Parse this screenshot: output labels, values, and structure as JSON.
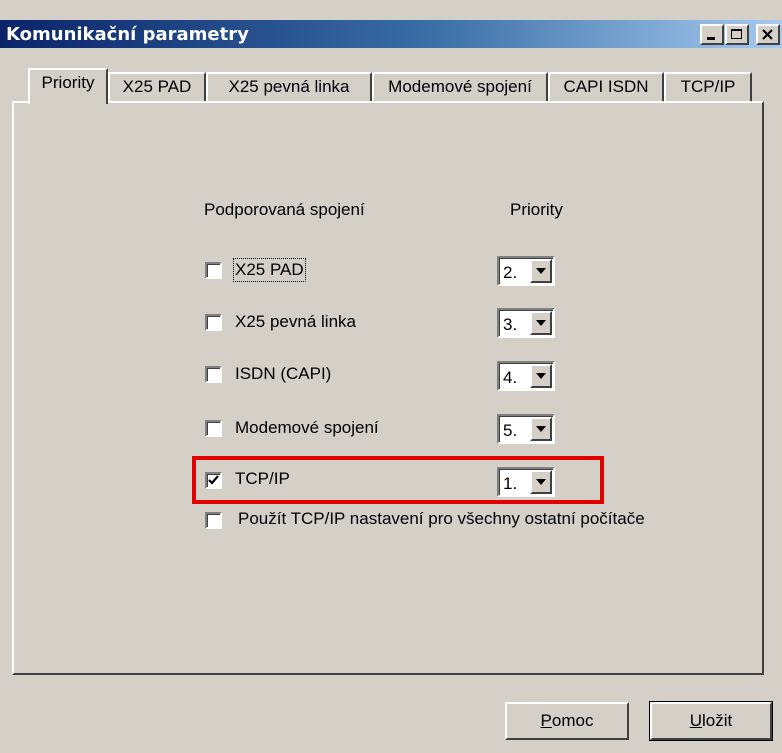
{
  "window": {
    "title": "Komunikační parametry",
    "accent_color": "#0a246a",
    "highlight_color": "#e00000"
  },
  "tabs": [
    {
      "label": "Priority",
      "active": true
    },
    {
      "label": "X25 PAD",
      "active": false
    },
    {
      "label": "X25  pevná linka",
      "active": false
    },
    {
      "label": "Modemové spojení",
      "active": false
    },
    {
      "label": "CAPI ISDN",
      "active": false
    },
    {
      "label": "TCP/IP",
      "active": false
    }
  ],
  "headers": {
    "connections": "Podporovaná spojení",
    "priority": "Priority"
  },
  "connections": [
    {
      "label": "X25 PAD",
      "checked": false,
      "priority": "2."
    },
    {
      "label": "X25 pevná linka",
      "checked": false,
      "priority": "3."
    },
    {
      "label": "ISDN (CAPI)",
      "checked": false,
      "priority": "4."
    },
    {
      "label": "Modemové spojení",
      "checked": false,
      "priority": "5."
    },
    {
      "label": "TCP/IP",
      "checked": true,
      "priority": "1."
    }
  ],
  "extra_option": {
    "label": "Použít TCP/IP nastavení pro všechny ostatní počítače",
    "checked": false
  },
  "buttons": {
    "help_first": "P",
    "help_rest": "omoc",
    "save_first": "U",
    "save_rest": "ložit"
  },
  "icons": {
    "minimize": "minimize-icon",
    "maximize": "maximize-icon",
    "close": "close-icon",
    "dropdown": "chevron-down-icon",
    "check": "checkmark-icon"
  }
}
